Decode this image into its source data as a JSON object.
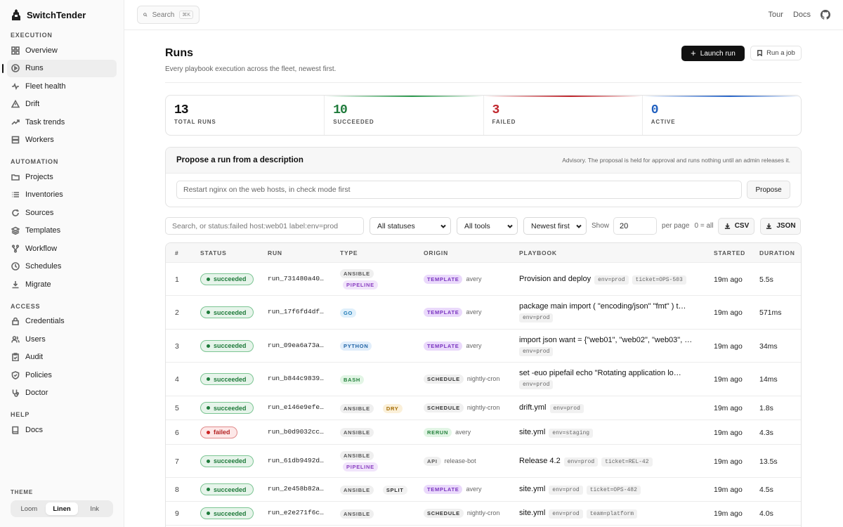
{
  "brand": {
    "name": "SwitchTender"
  },
  "sidebar": {
    "sections": [
      {
        "label": "EXECUTION",
        "items": [
          {
            "label": "Overview",
            "icon": "grid-icon"
          },
          {
            "label": "Runs",
            "icon": "play-circle-icon",
            "active": true
          },
          {
            "label": "Fleet health",
            "icon": "pulse-icon"
          },
          {
            "label": "Drift",
            "icon": "warning-triangle-icon"
          },
          {
            "label": "Task trends",
            "icon": "trend-up-icon"
          },
          {
            "label": "Workers",
            "icon": "server-icon"
          }
        ]
      },
      {
        "label": "AUTOMATION",
        "items": [
          {
            "label": "Projects",
            "icon": "folder-icon"
          },
          {
            "label": "Inventories",
            "icon": "list-icon"
          },
          {
            "label": "Sources",
            "icon": "refresh-icon"
          },
          {
            "label": "Templates",
            "icon": "layers-icon"
          },
          {
            "label": "Workflow",
            "icon": "workflow-icon"
          },
          {
            "label": "Schedules",
            "icon": "clock-icon"
          },
          {
            "label": "Migrate",
            "icon": "download-icon"
          }
        ]
      },
      {
        "label": "ACCESS",
        "items": [
          {
            "label": "Credentials",
            "icon": "lock-icon"
          },
          {
            "label": "Users",
            "icon": "users-icon"
          },
          {
            "label": "Audit",
            "icon": "clipboard-icon"
          },
          {
            "label": "Policies",
            "icon": "shield-icon"
          },
          {
            "label": "Doctor",
            "icon": "stethoscope-icon"
          }
        ]
      },
      {
        "label": "HELP",
        "items": [
          {
            "label": "Docs",
            "icon": "book-icon"
          }
        ]
      }
    ],
    "theme": {
      "label": "THEME",
      "options": [
        "Loom",
        "Linen",
        "Ink"
      ],
      "selected": "Linen"
    }
  },
  "topbar": {
    "search_label": "Search",
    "search_shortcut": "⌘K",
    "links": [
      "Tour",
      "Docs"
    ]
  },
  "page": {
    "title": "Runs",
    "subtitle": "Every playbook execution across the fleet, newest first.",
    "launch_label": "Launch run",
    "runjob_label": "Run a job"
  },
  "stats": [
    {
      "value": "13",
      "label": "TOTAL RUNS",
      "color": "#111111",
      "accent": "none"
    },
    {
      "value": "10",
      "label": "SUCCEEDED",
      "color": "#1e7a3a",
      "accent": "#2e9b4f"
    },
    {
      "value": "3",
      "label": "FAILED",
      "color": "#c0262d",
      "accent": "#c0262d"
    },
    {
      "value": "0",
      "label": "ACTIVE",
      "color": "#1f5fbf",
      "accent": "#2a66c9"
    }
  ],
  "propose": {
    "title": "Propose a run from a description",
    "note": "Advisory. The proposal is held for approval and runs nothing until an admin releases it.",
    "placeholder": "Restart nginx on the web hosts, in check mode first",
    "button": "Propose"
  },
  "filters": {
    "search_placeholder": "Search, or status:failed host:web01 label:env=prod",
    "status": "All statuses",
    "tool": "All tools",
    "sort": "Newest first",
    "show_label": "Show",
    "per_page": "20",
    "per_page_label": "per page",
    "zero_all": "0 = all",
    "csv": "CSV",
    "json": "JSON"
  },
  "table": {
    "headers": [
      "#",
      "STATUS",
      "RUN",
      "TYPE",
      "ORIGIN",
      "PLAYBOOK",
      "STARTED",
      "DURATION"
    ],
    "rows": [
      {
        "num": "1",
        "status": "succeeded",
        "run": "run_731480a40…",
        "types": [
          "ANSIBLE",
          "PIPELINE"
        ],
        "origin": "TEMPLATE",
        "by": "avery",
        "playbook": "Provision and deploy",
        "chips": [
          "env=prod",
          "ticket=OPS-503"
        ],
        "started": "19m ago",
        "duration": "5.5s"
      },
      {
        "num": "2",
        "status": "succeeded",
        "run": "run_17f6fd4df…",
        "types": [
          "GO"
        ],
        "origin": "TEMPLATE",
        "by": "avery",
        "playbook": "package main import ( \"encoding/json\" \"fmt\" ) t…",
        "chips": [
          "env=prod"
        ],
        "started": "19m ago",
        "duration": "571ms"
      },
      {
        "num": "3",
        "status": "succeeded",
        "run": "run_09ea6a73a…",
        "types": [
          "PYTHON"
        ],
        "origin": "TEMPLATE",
        "by": "avery",
        "playbook": "import json want = {\"web01\", \"web02\", \"web03\", …",
        "chips": [
          "env=prod"
        ],
        "started": "19m ago",
        "duration": "34ms"
      },
      {
        "num": "4",
        "status": "succeeded",
        "run": "run_b844c9839…",
        "types": [
          "BASH"
        ],
        "origin": "SCHEDULE",
        "by": "nightly-cron",
        "playbook": "set -euo pipefail echo \"Rotating application lo…",
        "chips": [
          "env=prod"
        ],
        "started": "19m ago",
        "duration": "14ms"
      },
      {
        "num": "5",
        "status": "succeeded",
        "run": "run_e146e9efe…",
        "types": [
          "ANSIBLE",
          "DRY"
        ],
        "origin": "SCHEDULE",
        "by": "nightly-cron",
        "playbook": "drift.yml",
        "chips": [
          "env=prod"
        ],
        "started": "19m ago",
        "duration": "1.8s"
      },
      {
        "num": "6",
        "status": "failed",
        "run": "run_b0d9032cc…",
        "types": [
          "ANSIBLE"
        ],
        "origin": "RERUN",
        "by": "avery",
        "playbook": "site.yml",
        "chips": [
          "env=staging"
        ],
        "started": "19m ago",
        "duration": "4.3s"
      },
      {
        "num": "7",
        "status": "succeeded",
        "run": "run_61db9492d…",
        "types": [
          "ANSIBLE",
          "PIPELINE"
        ],
        "origin": "API",
        "by": "release-bot",
        "playbook": "Release 4.2",
        "chips": [
          "env=prod",
          "ticket=REL-42"
        ],
        "started": "19m ago",
        "duration": "13.5s"
      },
      {
        "num": "8",
        "status": "succeeded",
        "run": "run_2e458b82a…",
        "types": [
          "ANSIBLE",
          "SPLIT"
        ],
        "origin": "TEMPLATE",
        "by": "avery",
        "playbook": "site.yml",
        "chips": [
          "env=prod",
          "ticket=OPS-482"
        ],
        "started": "19m ago",
        "duration": "4.5s"
      },
      {
        "num": "9",
        "status": "succeeded",
        "run": "run_e2e271f6c…",
        "types": [
          "ANSIBLE"
        ],
        "origin": "SCHEDULE",
        "by": "nightly-cron",
        "playbook": "site.yml",
        "chips": [
          "env=prod",
          "team=platform"
        ],
        "started": "19m ago",
        "duration": "4.0s"
      }
    ]
  }
}
